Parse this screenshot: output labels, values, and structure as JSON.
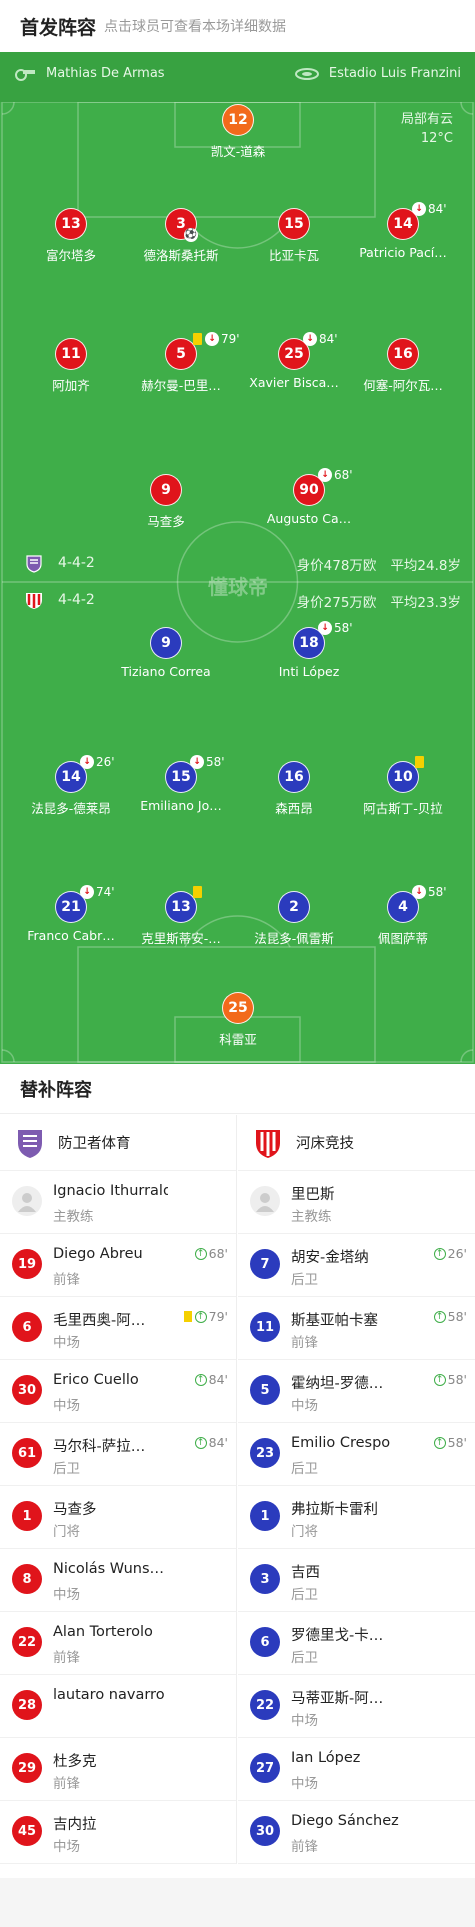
{
  "header": {
    "title": "首发阵容",
    "subtitle": "点击球员可查看本场详细数据"
  },
  "match": {
    "referee": "Mathias De Armas",
    "venue": "Estadio Luis Franzini",
    "weather": "局部有云",
    "temperature": "12°C"
  },
  "home_formation": {
    "formation": "4-4-2",
    "value": "身价478万欧",
    "age": "平均24.8岁"
  },
  "away_formation": {
    "formation": "4-4-2",
    "value": "身价275万欧",
    "age": "平均23.3岁"
  },
  "watermark": "懂球帝",
  "home_players": [
    {
      "num": "12",
      "name": "凯文-道森"
    },
    {
      "num": "13",
      "name": "富尔塔多"
    },
    {
      "num": "3",
      "name": "德洛斯桑托斯"
    },
    {
      "num": "15",
      "name": "比亚卡瓦"
    },
    {
      "num": "14",
      "name": "Patricio Pací…",
      "sub": "84'"
    },
    {
      "num": "11",
      "name": "阿加齐"
    },
    {
      "num": "5",
      "name": "赫尔曼-巴里…",
      "sub": "79'"
    },
    {
      "num": "25",
      "name": "Xavier Bisca…",
      "sub": "84'"
    },
    {
      "num": "16",
      "name": "何塞-阿尔瓦…"
    },
    {
      "num": "9",
      "name": "马查多"
    },
    {
      "num": "90",
      "name": "Augusto Ca…",
      "sub": "68'"
    }
  ],
  "away_players": [
    {
      "num": "9",
      "name": "Tiziano Correa"
    },
    {
      "num": "18",
      "name": "Inti López",
      "sub": "58'"
    },
    {
      "num": "14",
      "name": "法昆多-德莱昂",
      "sub": "26'"
    },
    {
      "num": "15",
      "name": "Emiliano Jo…",
      "sub": "58'"
    },
    {
      "num": "16",
      "name": "森西昂"
    },
    {
      "num": "10",
      "name": "阿古斯丁-贝拉"
    },
    {
      "num": "21",
      "name": "Franco Cabr…",
      "sub": "74'"
    },
    {
      "num": "13",
      "name": "克里斯蒂安-…"
    },
    {
      "num": "2",
      "name": "法昆多-佩雷斯"
    },
    {
      "num": "4",
      "name": "佩图萨蒂",
      "sub": "58'"
    },
    {
      "num": "25",
      "name": "科雷亚"
    }
  ],
  "subs": {
    "title": "替补阵容",
    "home": {
      "team": "防卫者体育",
      "coach": {
        "name": "Ignacio Ithurralde",
        "role": "主教练"
      },
      "players": [
        {
          "num": "19",
          "name": "Diego Abreu",
          "pos": "前锋",
          "in": "68'"
        },
        {
          "num": "6",
          "name": "毛里西奥-阿…",
          "pos": "中场",
          "in": "79'",
          "yellow": true
        },
        {
          "num": "30",
          "name": "Erico Cuello",
          "pos": "中场",
          "in": "84'"
        },
        {
          "num": "61",
          "name": "马尔科-萨拉…",
          "pos": "后卫",
          "in": "84'"
        },
        {
          "num": "1",
          "name": "马查多",
          "pos": "门将"
        },
        {
          "num": "8",
          "name": "Nicolás Wuns…",
          "pos": "中场"
        },
        {
          "num": "22",
          "name": "Alan Torterolo",
          "pos": "前锋"
        },
        {
          "num": "28",
          "name": "lautaro navarro",
          "pos": ""
        },
        {
          "num": "29",
          "name": "杜多克",
          "pos": "前锋"
        },
        {
          "num": "45",
          "name": "吉内拉",
          "pos": "中场"
        }
      ]
    },
    "away": {
      "team": "河床竞技",
      "coach": {
        "name": "里巴斯",
        "role": "主教练"
      },
      "players": [
        {
          "num": "7",
          "name": "胡安-金塔纳",
          "pos": "后卫",
          "in": "26'"
        },
        {
          "num": "11",
          "name": "斯基亚帕卡塞",
          "pos": "前锋",
          "in": "58'"
        },
        {
          "num": "5",
          "name": "霍纳坦-罗德…",
          "pos": "中场",
          "in": "58'"
        },
        {
          "num": "23",
          "name": "Emilio Crespo",
          "pos": "后卫",
          "in": "58'"
        },
        {
          "num": "1",
          "name": "弗拉斯卡雷利",
          "pos": "门将"
        },
        {
          "num": "3",
          "name": "吉西",
          "pos": "后卫"
        },
        {
          "num": "6",
          "name": "罗德里戈-卡…",
          "pos": "后卫"
        },
        {
          "num": "22",
          "name": "马蒂亚斯-阿…",
          "pos": "中场"
        },
        {
          "num": "27",
          "name": "Ian López",
          "pos": "中场"
        },
        {
          "num": "30",
          "name": "Diego Sánchez",
          "pos": "前锋"
        }
      ]
    }
  },
  "colors": {
    "pitch": "#3fae49",
    "home": "#e0141b",
    "away": "#2b3bbd",
    "goalkeeper": "#f26a1b",
    "yellow_card": "#f5d000"
  }
}
